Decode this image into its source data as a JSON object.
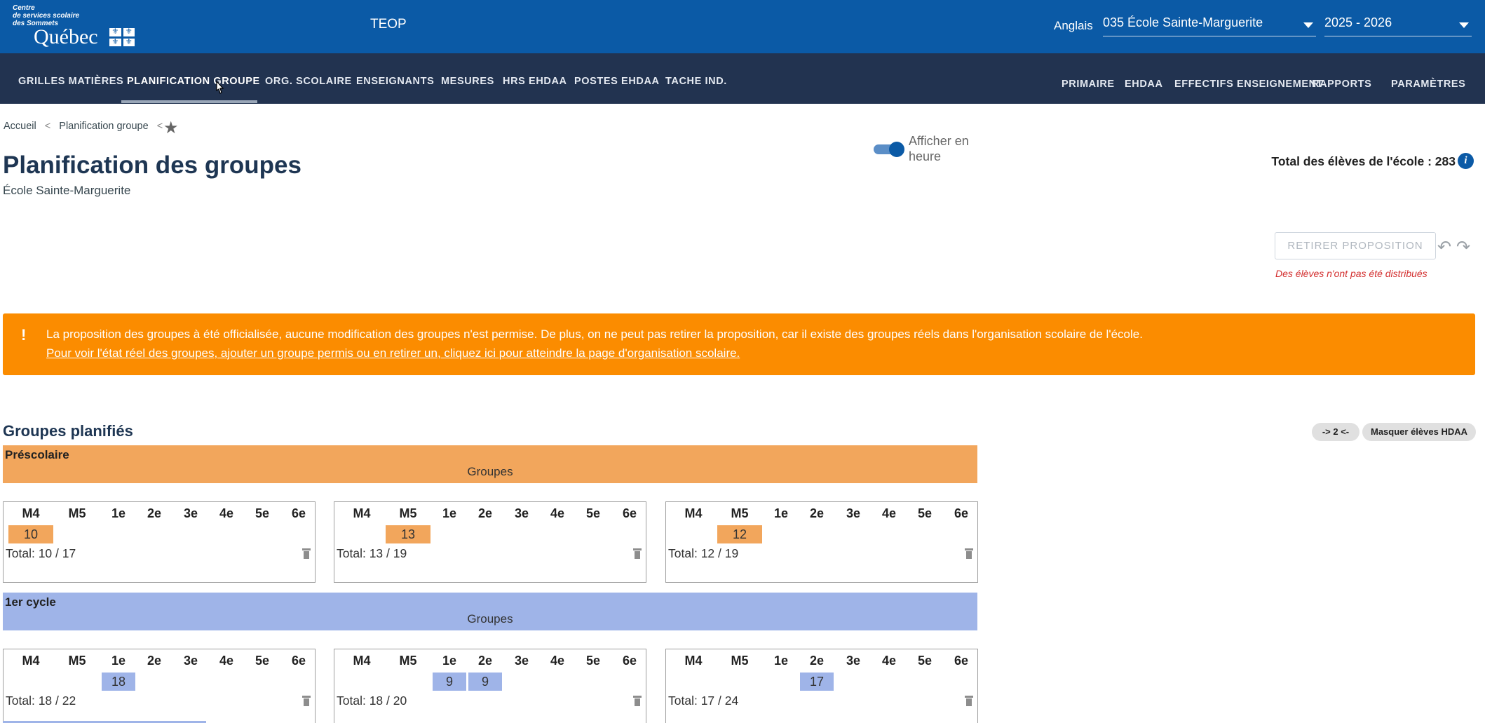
{
  "header": {
    "logo_lines": [
      "Centre",
      "de services scolaire",
      "des Sommets"
    ],
    "logo_name": "Québec",
    "app_name": "TEOP",
    "language": "Anglais",
    "school_select": "035 École Sainte-Marguerite",
    "year_select": "2025 - 2026"
  },
  "nav": {
    "left": [
      "GRILLES MATIÈRES",
      "PLANIFICATION GROUPE",
      "ORG. SCOLAIRE",
      "ENSEIGNANTS",
      "MESURES",
      "HRS EHDAA",
      "POSTES EHDAA",
      "TACHE IND."
    ],
    "right": [
      "PRIMAIRE",
      "EHDAA",
      "EFFECTIFS ENSEIGNEMENT",
      "RAPPORTS",
      "PARAMÈTRES"
    ],
    "active": "PLANIFICATION GROUPE"
  },
  "breadcrumb": [
    "Accueil",
    "Planification groupe"
  ],
  "page": {
    "title": "Planification des groupes",
    "subtitle": "École Sainte-Marguerite",
    "toggle_label": "Afficher en heure",
    "total_students": "Total des élèves de l'école : 283",
    "retirer_button": "RETIRER PROPOSITION",
    "warning": "Des élèves n'ont pas été distribués"
  },
  "alert": {
    "icon": "!",
    "line1": "La proposition des groupes à été officialisée, aucune modification des groupes n'est permise. De plus, on ne peut pas retirer la proposition, car il existe des groupes réels dans l'organisation scolaire de l'école.",
    "link": "Pour voir l'état réel des groupes, ajouter un groupe permis ou en retirer un, cliquez ici pour atteindre la page d'organisation scolaire."
  },
  "groups_section": {
    "title": "Groupes planifiés",
    "zoom_chip": "-> 2 <-",
    "hdaa_chip": "Masquer élèves HDAA",
    "levels": [
      "M4",
      "M5",
      "1e",
      "2e",
      "3e",
      "4e",
      "5e",
      "6e"
    ],
    "colors": {
      "prescolaire": "#f2a65c",
      "cycle1": "#9fb4e8",
      "alert": "#fb8c00",
      "header": "#0b5aa6",
      "nav": "#223350"
    },
    "cycles": [
      {
        "name": "Préscolaire",
        "label": "Groupes",
        "cards": [
          {
            "cells": [
              {
                "level": "M4",
                "value": "10"
              }
            ],
            "total": "Total: 10 / 17"
          },
          {
            "cells": [
              {
                "level": "M5",
                "value": "13"
              }
            ],
            "total": "Total: 13 / 19"
          },
          {
            "cells": [
              {
                "level": "M5",
                "value": "12"
              }
            ],
            "total": "Total: 12 / 19"
          }
        ]
      },
      {
        "name": "1er cycle",
        "label": "Groupes",
        "cards": [
          {
            "cells": [
              {
                "level": "1e",
                "value": "18"
              }
            ],
            "total": "Total: 18 / 22"
          },
          {
            "cells": [
              {
                "level": "1e",
                "value": "9"
              },
              {
                "level": "2e",
                "value": "9"
              }
            ],
            "total": "Total: 18 / 20"
          },
          {
            "cells": [
              {
                "level": "2e",
                "value": "17"
              }
            ],
            "total": "Total: 17 / 24"
          }
        ]
      }
    ]
  }
}
